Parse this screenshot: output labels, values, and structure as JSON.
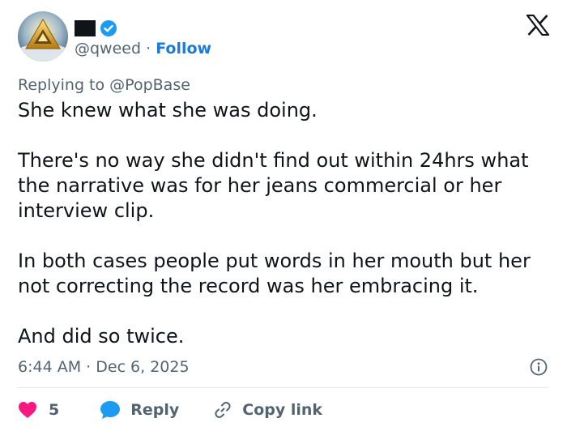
{
  "colors": {
    "accent": "#1d7bd8",
    "text": "#0f1419",
    "muted": "#536471",
    "like": "#f91880",
    "reply_bubble": "#1d9bf0",
    "divider": "#e7e9eb"
  },
  "header": {
    "avatar_icon": "golden-pyramid-avatar",
    "verified_icon": "verified-badge-icon",
    "handle": "@qweed",
    "separator": "·",
    "follow_label": "Follow",
    "platform_icon": "x-logo-icon"
  },
  "reply_context": {
    "prefix": "Replying to",
    "mention": "@PopBase"
  },
  "tweet": {
    "paragraphs": [
      "She knew what she was doing.",
      "There's no way she didn't find out within 24hrs what the narrative was for her jeans commercial or her interview clip.",
      "In both cases people put words in her mouth but her not correcting the record was her embracing it.",
      "And did so twice."
    ]
  },
  "meta": {
    "time": "6:44 AM",
    "separator": "·",
    "date": "Dec 6, 2025",
    "info_icon": "info-icon"
  },
  "actions": {
    "like_icon": "heart-icon",
    "like_count": "5",
    "reply_icon": "speech-bubble-icon",
    "reply_label": "Reply",
    "copy_icon": "link-icon",
    "copy_label": "Copy link"
  }
}
